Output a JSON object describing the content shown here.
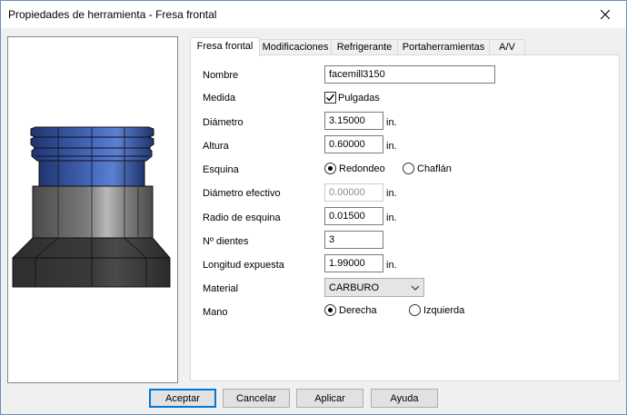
{
  "window": {
    "title": "Propiedades de herramienta - Fresa frontal"
  },
  "tabs": [
    {
      "label": "Fresa frontal"
    },
    {
      "label": "Modificaciones"
    },
    {
      "label": "Refrigerante"
    },
    {
      "label": "Portaherramientas"
    },
    {
      "label": "A/V"
    }
  ],
  "form": {
    "nombre": {
      "label": "Nombre",
      "value": "facemill3150"
    },
    "medida": {
      "label": "Medida",
      "checkbox_label": "Pulgadas",
      "checked": true
    },
    "diametro": {
      "label": "Diámetro",
      "value": "3.15000",
      "unit": "in."
    },
    "altura": {
      "label": "Altura",
      "value": "0.60000",
      "unit": "in."
    },
    "esquina": {
      "label": "Esquina",
      "option1": "Redondeo",
      "option2": "Chaflán",
      "selected": "Redondeo"
    },
    "diametro_efectivo": {
      "label": "Diámetro efectivo",
      "value": "0.00000",
      "unit": "in."
    },
    "radio_esquina": {
      "label": "Radio de esquina",
      "value": "0.01500",
      "unit": "in."
    },
    "dientes": {
      "label": "Nº dientes",
      "value": "3"
    },
    "longitud_expuesta": {
      "label": "Longitud expuesta",
      "value": "1.99000",
      "unit": "in."
    },
    "material": {
      "label": "Material",
      "value": "CARBURO"
    },
    "mano": {
      "label": "Mano",
      "option1": "Derecha",
      "option2": "Izquierda",
      "selected": "Derecha"
    }
  },
  "buttons": {
    "accept": "Aceptar",
    "cancel": "Cancelar",
    "apply": "Aplicar",
    "help": "Ayuda"
  },
  "icons": {
    "close": "close-icon",
    "check": "check-icon",
    "dropdown": "chevron-down-icon"
  },
  "colors": {
    "tool_body_blue": "#2f4f96",
    "tool_body_gray": "#6f6f6f",
    "default_button_border": "#0078d7"
  }
}
